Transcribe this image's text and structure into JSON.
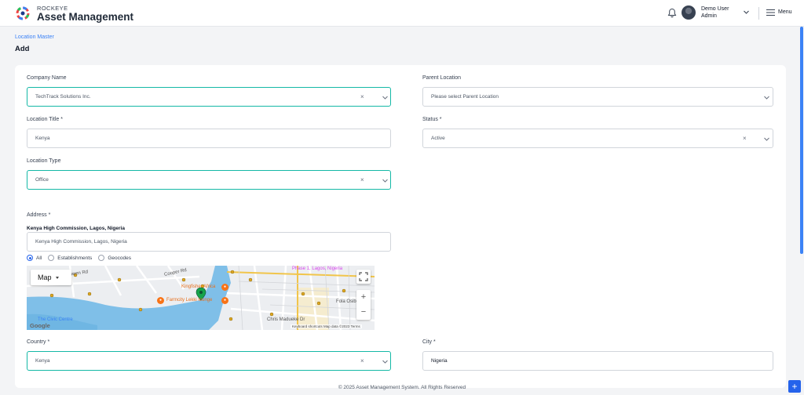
{
  "header": {
    "brand_small": "ROCKEYE",
    "brand_title": "Asset Management",
    "user_name": "Demo User",
    "user_role": "Admin",
    "menu_label": "Menu"
  },
  "breadcrumb": "Location Master",
  "page_title": "Add",
  "form": {
    "company_name": {
      "label": "Company Name",
      "value": "TechTrack Solutions Inc."
    },
    "parent_location": {
      "label": "Parent Location",
      "placeholder": "Please select Parent Location"
    },
    "location_title": {
      "label": "Location Title *",
      "value": "Kenya"
    },
    "status": {
      "label": "Status *",
      "value": "Active"
    },
    "location_type": {
      "label": "Location Type",
      "value": "Office"
    },
    "address": {
      "label": "Address *",
      "selected": "Kenya High Commission, Lagos, Nigeria",
      "value": "Kenya High Commission, Lagos, Nigeria"
    },
    "address_filters": [
      "All",
      "Establishments",
      "Geocodes"
    ],
    "country": {
      "label": "Country *",
      "value": "Kenya"
    },
    "city": {
      "label": "City *",
      "value": "Nigeria"
    }
  },
  "map": {
    "type_button": "Map",
    "labels": {
      "mekunwen": "Mekunwen Rd",
      "cooper": "Cooper Rd",
      "kingfisher": "Kingfisher Africa",
      "farmcity": "Farmcity Lekki lounge",
      "fola": "Fola Osibo",
      "chris": "Chris Madueke Dr",
      "phase": "Phase 1, Lagos, Nigeria",
      "civic": "The Civic Centre"
    },
    "attribution": "Keyboard shortcuts   Map data ©2023   Terms",
    "google": "Google"
  },
  "footer": "© 2025 Asset Management System. All Rights Reserved",
  "colors": {
    "accent": "#14b8a6",
    "link": "#3b82f6",
    "primary": "#2563eb"
  }
}
